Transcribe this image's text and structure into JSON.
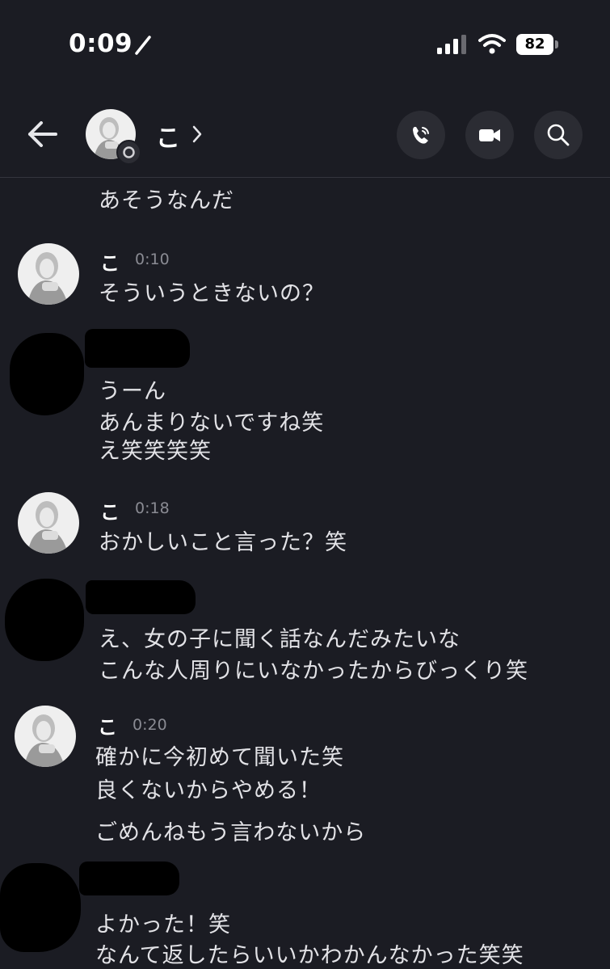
{
  "status_bar": {
    "time": "0:09",
    "battery": "82",
    "icons": [
      "pencil-icon",
      "signal-icon",
      "wifi-icon",
      "battery-icon"
    ]
  },
  "header": {
    "contact_name": "こ",
    "icons": [
      "back-arrow-icon",
      "chevron-right-icon",
      "phone-call-icon",
      "video-camera-icon",
      "search-icon"
    ]
  },
  "messages": [
    {
      "sender": "",
      "time": "",
      "lines": [
        "あそうなんだ"
      ]
    },
    {
      "sender": "こ",
      "time": "0:10",
      "lines": [
        "そういうときないの？"
      ]
    },
    {
      "sender": "",
      "time": "",
      "lines": [
        "うーん",
        "あんまりないですね笑",
        "え笑笑笑笑"
      ]
    },
    {
      "sender": "こ",
      "time": "0:18",
      "lines": [
        "おかしいこと言った？笑"
      ]
    },
    {
      "sender": "",
      "time": "",
      "lines": [
        "え、女の子に聞く話なんだみたいな",
        "こんな人周りにいなかったからびっくり笑"
      ]
    },
    {
      "sender": "こ",
      "time": "0:20",
      "lines": [
        "確かに今初めて聞いた笑",
        "良くないからやめる！",
        "ごめんねもう言わないから"
      ]
    },
    {
      "sender": "",
      "time": "",
      "lines": [
        "よかった！笑",
        "なんて返したらいいかわかんなかった笑笑"
      ]
    }
  ]
}
